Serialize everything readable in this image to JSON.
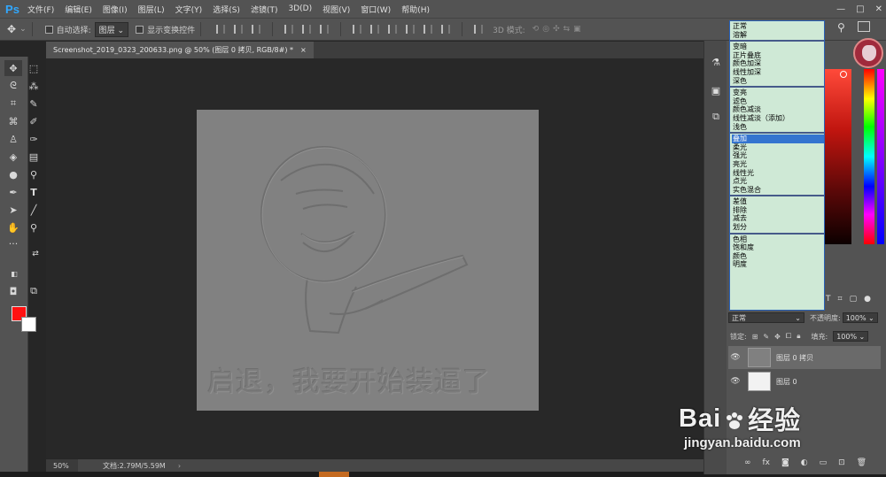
{
  "app": {
    "logo": "Ps"
  },
  "menu": [
    "文件(F)",
    "编辑(E)",
    "图像(I)",
    "图层(L)",
    "文字(Y)",
    "选择(S)",
    "滤镜(T)",
    "3D(D)",
    "视图(V)",
    "窗口(W)",
    "帮助(H)"
  ],
  "window_controls": [
    "—",
    "□",
    "✕"
  ],
  "options": {
    "auto_select_label": "自动选择:",
    "auto_select_value": "图层",
    "show_transform_label": "显示变换控件",
    "mode_3d_label": "3D 模式:"
  },
  "tab": {
    "title": "Screenshot_2019_0323_200633.png @ 50% (图层 0 拷贝, RGB/8#) *",
    "close": "×"
  },
  "canvas": {
    "embossed_text": "启退，我要开始装逼了"
  },
  "status": {
    "zoom": "50%",
    "doc_info": "文档:2.79M/5.59M",
    "arrow": "›"
  },
  "blend_modes": [
    [
      "正常",
      "溶解"
    ],
    [
      "变暗",
      "正片叠底",
      "颜色加深",
      "线性加深",
      "深色"
    ],
    [
      "变亮",
      "滤色",
      "颜色减淡",
      "线性减淡（添加）",
      "浅色"
    ],
    [
      "叠加",
      "柔光",
      "强光",
      "亮光",
      "线性光",
      "点光",
      "实色混合"
    ],
    [
      "差值",
      "排除",
      "减去",
      "划分"
    ],
    [
      "色相",
      "饱和度",
      "颜色",
      "明度"
    ]
  ],
  "blend_highlight": "叠加",
  "layers_panel": {
    "blend_value": "正常",
    "opacity_label": "不透明度:",
    "opacity_value": "100%",
    "lock_label": "锁定:",
    "fill_label": "填充:",
    "fill_value": "100%",
    "layers": [
      {
        "name": "图层 0 拷贝",
        "selected": true
      },
      {
        "name": "图层 0",
        "selected": false
      }
    ],
    "footer_icons": [
      "link-icon",
      "fx-icon",
      "mask-icon",
      "adjustment-icon",
      "folder-icon",
      "new-layer-icon",
      "trash-icon"
    ]
  },
  "colors": {
    "foreground": "#ff1111",
    "background": "#ffffff",
    "accent": "#31a8ff",
    "highlight": "#3474cf"
  },
  "watermark": {
    "logo_left": "Bai",
    "logo_right": "经验",
    "url": "jingyan.baidu.com"
  }
}
